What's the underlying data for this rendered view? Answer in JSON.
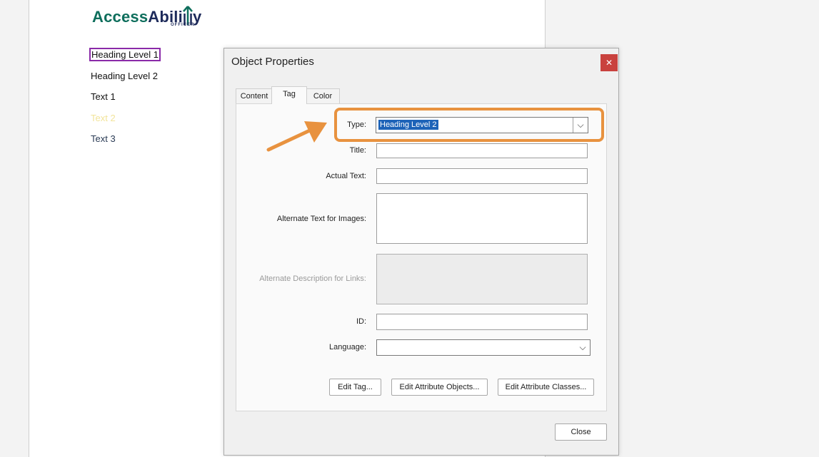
{
  "logo": {
    "part1": "Access",
    "part2": "Abili",
    "part3": "y",
    "subtitle": "OFFICER"
  },
  "document": {
    "items": [
      {
        "label": "Heading Level 1"
      },
      {
        "label": "Heading Level 2"
      },
      {
        "label": "Text 1"
      },
      {
        "label": "Text 2"
      },
      {
        "label": "Text 3"
      }
    ]
  },
  "dialog": {
    "title": "Object Properties",
    "close_glyph": "✕",
    "tabs": [
      "Content",
      "Tag",
      "Color"
    ],
    "active_tab": "Tag",
    "labels": {
      "type": "Type:",
      "title": "Title:",
      "actual_text": "Actual Text:",
      "alt_text": "Alternate Text for Images:",
      "alt_desc": "Alternate Description for Links:",
      "id": "ID:",
      "language": "Language:"
    },
    "type_value": "Heading Level 2",
    "language_value": "",
    "buttons": {
      "edit_tag": "Edit Tag...",
      "edit_attr_objects": "Edit Attribute Objects...",
      "edit_attr_classes": "Edit Attribute Classes...",
      "close": "Close"
    },
    "chevron_glyph": "⌵"
  },
  "colors": {
    "highlight": "#e8923f",
    "selection": "#1d63b8",
    "close_button": "#c9423e",
    "heading_box": "#8a2aa8"
  }
}
